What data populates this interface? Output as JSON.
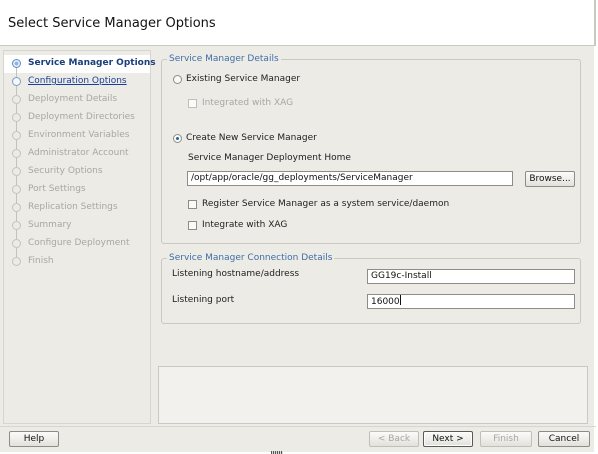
{
  "header": {
    "title": "Select Service Manager Options"
  },
  "steps": [
    {
      "label": "Service Manager Options",
      "state": "current"
    },
    {
      "label": "Configuration Options",
      "state": "next"
    },
    {
      "label": "Deployment Details",
      "state": "disabled"
    },
    {
      "label": "Deployment Directories",
      "state": "disabled"
    },
    {
      "label": "Environment Variables",
      "state": "disabled"
    },
    {
      "label": "Administrator Account",
      "state": "disabled"
    },
    {
      "label": "Security Options",
      "state": "disabled"
    },
    {
      "label": "Port Settings",
      "state": "disabled"
    },
    {
      "label": "Replication Settings",
      "state": "disabled"
    },
    {
      "label": "Summary",
      "state": "disabled"
    },
    {
      "label": "Configure Deployment",
      "state": "disabled"
    },
    {
      "label": "Finish",
      "state": "disabled"
    }
  ],
  "details": {
    "legend": "Service Manager Details",
    "existing_label": "Existing Service Manager",
    "existing_selected": false,
    "integrated_xag_label": "Integrated with XAG",
    "create_label": "Create New Service Manager",
    "create_selected": true,
    "home_label": "Service Manager Deployment Home",
    "home_value": "/opt/app/oracle/gg_deployments/ServiceManager",
    "browse_label": "Browse...",
    "register_label": "Register Service Manager as a system service/daemon",
    "register_checked": false,
    "integrate_xag_label": "Integrate with XAG",
    "integrate_xag_checked": false
  },
  "connection": {
    "legend": "Service Manager Connection Details",
    "hostname_label": "Listening hostname/address",
    "hostname_value": "GG19c-Install",
    "port_label": "Listening port",
    "port_value": "16000"
  },
  "footer": {
    "help_label": "Help",
    "back_label": "< Back",
    "next_label": "Next >",
    "finish_label": "Finish",
    "cancel_label": "Cancel"
  },
  "colors": {
    "accent": "#3f6ea6",
    "current_step": "#1a3f7a",
    "background": "#ecebe6"
  }
}
